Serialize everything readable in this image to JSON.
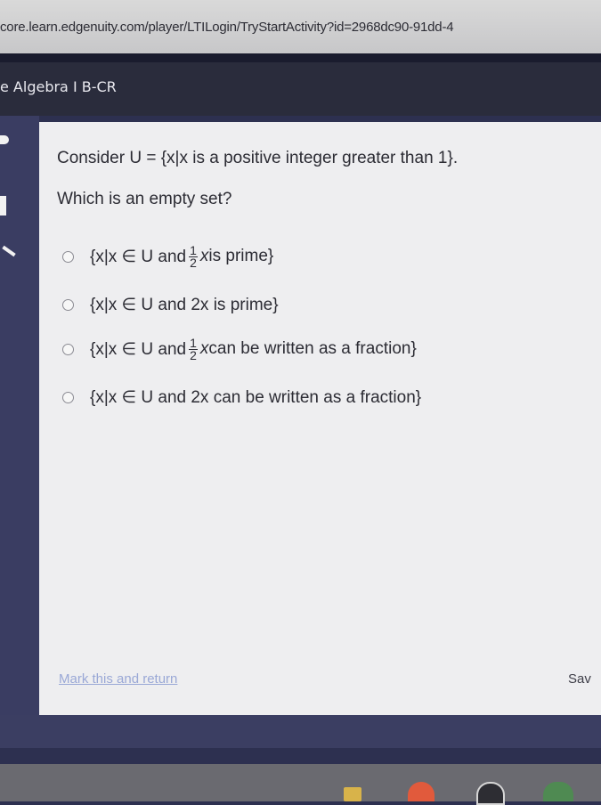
{
  "browser": {
    "url": "core.learn.edgenuity.com/player/LTILogin/TryStartActivity?id=2968dc90-91dd-4"
  },
  "course": {
    "title": "e Algebra I B-CR"
  },
  "question": {
    "line1": "Consider U = {x|x is a positive integer greater than 1}.",
    "line2": "Which is an empty set?"
  },
  "options": [
    {
      "pre": "{x|x ∈ U and",
      "frac_num": "1",
      "frac_den": "2",
      "var": "x",
      "post": " is prime}"
    },
    {
      "text": "{x|x ∈ U and 2x is prime}"
    },
    {
      "pre": "{x|x ∈ U and",
      "frac_num": "1",
      "frac_den": "2",
      "var": "x",
      "post": " can be written as a fraction}"
    },
    {
      "text": "{x|x ∈ U and 2x can be written as a fraction}"
    }
  ],
  "footer": {
    "mark_link": "Mark this and return",
    "save_link": "Sav"
  },
  "icons": {
    "rail": [
      "arrow-icon",
      "document-icon",
      "pen-icon"
    ],
    "taskbar": [
      "files-icon",
      "chrome-icon",
      "app-icon",
      "app-icon-2"
    ]
  },
  "colors": {
    "page_background": "#2d3050",
    "card_background": "#eeeef0",
    "link": "#9aa8d6"
  }
}
